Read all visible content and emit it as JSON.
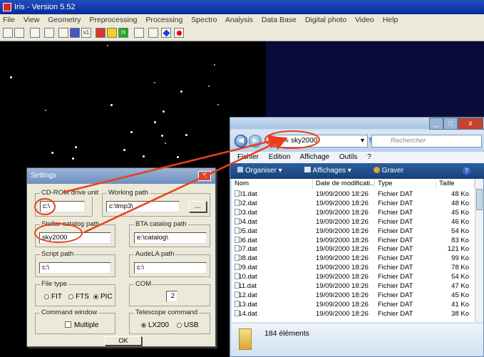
{
  "iris": {
    "title": "Iris - Version 5.52",
    "menu": [
      "File",
      "View",
      "Geometry",
      "Preprocessing",
      "Processing",
      "Spectro",
      "Analysis",
      "Data Base",
      "Digital photo",
      "Video",
      "Help"
    ],
    "toolbar_text": {
      "zoom_label": "x1",
      "histogram_label": "H"
    }
  },
  "settings": {
    "title": "Settings",
    "close_label": "X",
    "cdrom_label": "CD-ROM drive unit",
    "cdrom_value": "c:\\",
    "working_label": "Working path",
    "working_value": "c:\\tmp3\\",
    "browse_label": "...",
    "stellar_label": "Stellar catalog path",
    "stellar_value": "sky2000",
    "bta_label": "BTA catalog path",
    "bta_value": "e:\\catalog\\",
    "script_label": "Script path",
    "script_value": "c:\\",
    "audela_label": "AudeLA path",
    "audela_value": "c:\\",
    "filetype_label": "File type",
    "filetype_options": [
      "FIT",
      "FTS",
      "PIC"
    ],
    "com_label": "COM",
    "com_value": "2",
    "cmdwin_label": "Command window",
    "multiple_label": "Multiple",
    "telescope_label": "Telescope command",
    "telescope_options": [
      "LX200",
      "USB"
    ],
    "ok_label": "OK"
  },
  "explorer": {
    "address_prefix": "«",
    "address": "sky2000",
    "search_placeholder": "Rechercher",
    "menu": [
      "Fichier",
      "Edition",
      "Affichage",
      "Outils",
      "?"
    ],
    "toolbar": [
      "Organiser ▾",
      "Affichages ▾",
      "Graver"
    ],
    "columns": [
      "Nom",
      "Date de modificati...",
      "Type",
      "Taille"
    ],
    "files": [
      {
        "name": "001.dat",
        "date": "19/09/2000 18:26",
        "type": "Fichier DAT",
        "size": "48 Ko"
      },
      {
        "name": "002.dat",
        "date": "19/09/2000 18:26",
        "type": "Fichier DAT",
        "size": "48 Ko"
      },
      {
        "name": "003.dat",
        "date": "19/09/2000 18:26",
        "type": "Fichier DAT",
        "size": "45 Ko"
      },
      {
        "name": "004.dat",
        "date": "19/09/2000 18:26",
        "type": "Fichier DAT",
        "size": "46 Ko"
      },
      {
        "name": "005.dat",
        "date": "19/09/2000 18:26",
        "type": "Fichier DAT",
        "size": "54 Ko"
      },
      {
        "name": "006.dat",
        "date": "19/09/2000 18:26",
        "type": "Fichier DAT",
        "size": "83 Ko"
      },
      {
        "name": "007.dat",
        "date": "19/09/2000 18:26",
        "type": "Fichier DAT",
        "size": "121 Ko"
      },
      {
        "name": "008.dat",
        "date": "19/09/2000 18:26",
        "type": "Fichier DAT",
        "size": "99 Ko"
      },
      {
        "name": "009.dat",
        "date": "19/09/2000 18:26",
        "type": "Fichier DAT",
        "size": "78 Ko"
      },
      {
        "name": "010.dat",
        "date": "19/09/2000 18:26",
        "type": "Fichier DAT",
        "size": "54 Ko"
      },
      {
        "name": "011.dat",
        "date": "19/09/2000 18:26",
        "type": "Fichier DAT",
        "size": "47 Ko"
      },
      {
        "name": "012.dat",
        "date": "19/09/2000 18:26",
        "type": "Fichier DAT",
        "size": "45 Ko"
      },
      {
        "name": "013.dat",
        "date": "19/09/2000 18:26",
        "type": "Fichier DAT",
        "size": "41 Ko"
      },
      {
        "name": "014.dat",
        "date": "19/09/2000 18:26",
        "type": "Fichier DAT",
        "size": "38 Ko"
      }
    ],
    "status_count": "184 éléments"
  },
  "colors": {
    "annotation": "#e8401c",
    "desktop_background": "#0b0b3a"
  }
}
